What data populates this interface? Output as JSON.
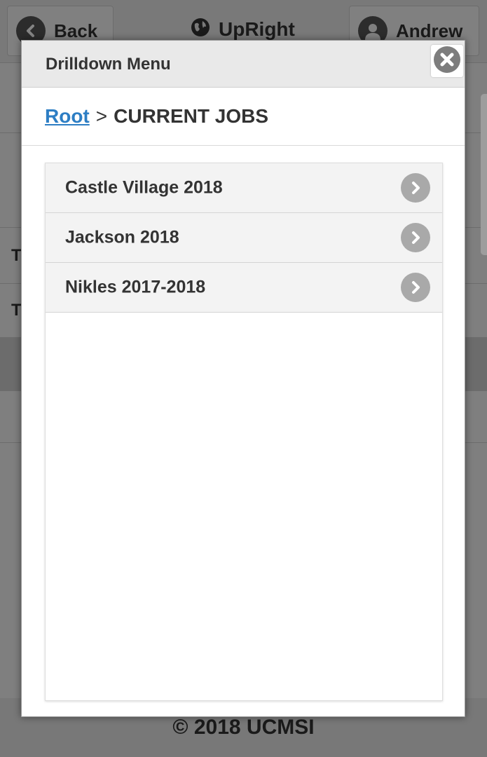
{
  "header": {
    "back_label": "Back",
    "app_title": "UpRight",
    "user_name": "Andrew"
  },
  "background_rows": [
    {
      "label": ""
    },
    {
      "label": ""
    },
    {
      "label": "T"
    },
    {
      "label": "T"
    },
    {
      "label": ""
    }
  ],
  "footer": {
    "copyright": "© 2018 UCMSI"
  },
  "modal": {
    "title": "Drilldown Menu",
    "breadcrumb": {
      "root_label": "Root",
      "separator": ">",
      "current_label": "CURRENT JOBS"
    },
    "items": [
      {
        "label": "Castle Village 2018"
      },
      {
        "label": "Jackson 2018"
      },
      {
        "label": "Nikles 2017-2018"
      }
    ]
  },
  "colors": {
    "link": "#2d7ec4",
    "header_bg": "#e9e9e9",
    "chevron_bg": "#a9a9a9",
    "overlay": "rgba(0,0,0,0.48)"
  },
  "icons": {
    "back": "chevron-left-icon",
    "app": "globe-icon",
    "user": "user-icon",
    "close": "close-icon",
    "item": "chevron-right-icon"
  }
}
